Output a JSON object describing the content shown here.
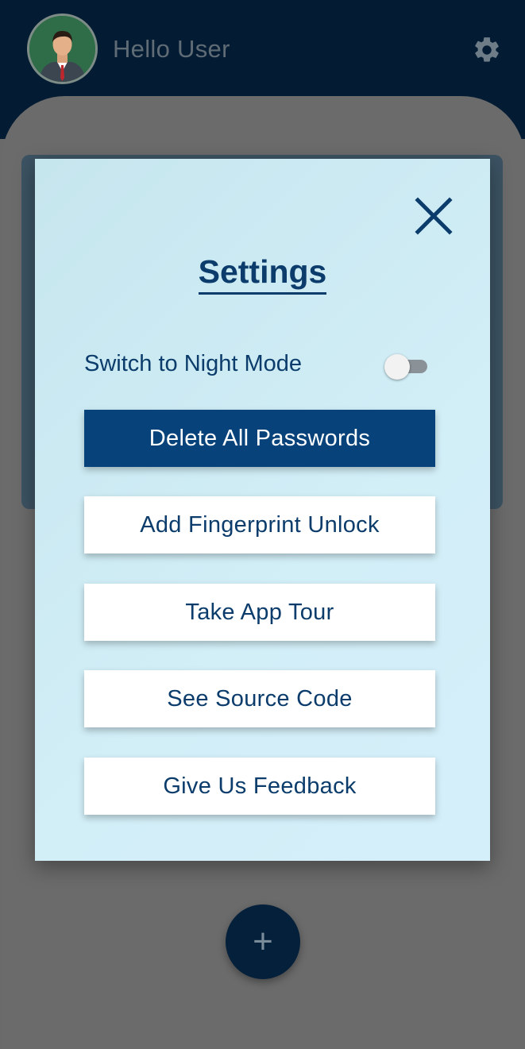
{
  "header": {
    "greeting": "Hello User",
    "avatar_icon": "user-avatar",
    "settings_icon": "gear-icon"
  },
  "dialog": {
    "title": "Settings",
    "close_icon": "close-icon",
    "night_mode_label": "Switch to Night Mode",
    "night_mode_on": false,
    "buttons": [
      {
        "label": "Delete All Passwords",
        "primary": true
      },
      {
        "label": "Add Fingerprint Unlock",
        "primary": false
      },
      {
        "label": "Take App Tour",
        "primary": false
      },
      {
        "label": "See Source Code",
        "primary": false
      },
      {
        "label": "Give Us Feedback",
        "primary": false
      }
    ]
  },
  "fab": {
    "label": "+",
    "icon": "plus-icon"
  },
  "colors": {
    "header_bg": "#031c33",
    "accent": "#0b3c6b",
    "primary_button": "#07437a",
    "dialog_bg": "#cbe9f2"
  }
}
